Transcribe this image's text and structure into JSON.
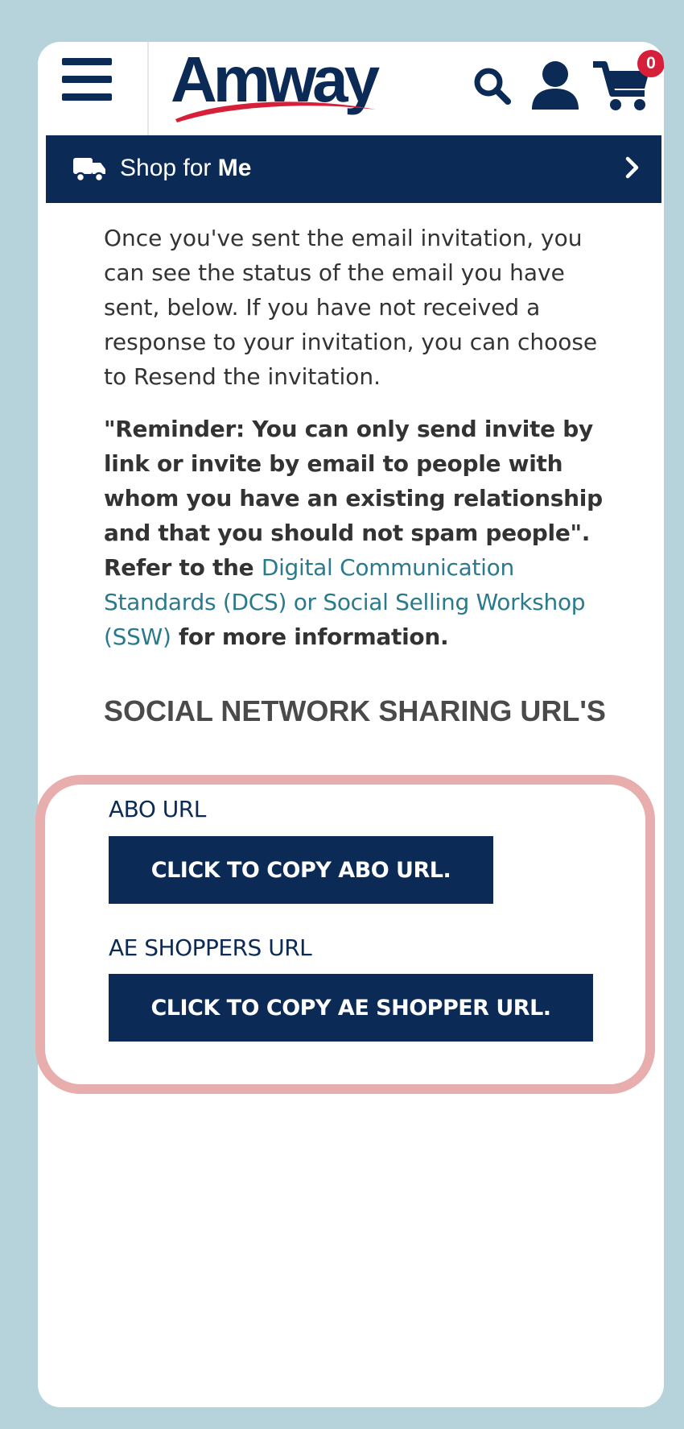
{
  "header": {
    "logo_text": "Amway",
    "cart_count": "0"
  },
  "shop_bar": {
    "prefix": "Shop for ",
    "target": "Me"
  },
  "content": {
    "intro": "Once you've sent the email invitation, you can see the status of the email you have sent, below. If you have not received a response to your invitation, you can choose to Resend the invitation.",
    "reminder": "\"Reminder: You can only send invite by link or invite by email to people with whom you have an existing relationship and that you should not spam people\". Refer to the",
    "link_text": "Digital Communication Standards (DCS) or Social Selling Workshop (SSW)",
    "reminder_suffix": "for more information."
  },
  "sharing": {
    "section_title": "SOCIAL NETWORK SHARING URL'S",
    "abo_label": "ABO URL",
    "abo_button": "CLICK TO COPY ABO URL.",
    "ae_label": "AE SHOPPERS URL",
    "ae_button": "CLICK TO COPY AE SHOPPER URL."
  },
  "colors": {
    "navy": "#0b2a55",
    "link": "#2b7a8c",
    "highlight": "#e8aeae",
    "frame": "#b6d3db",
    "badge": "#d6203a"
  },
  "icons": [
    "hamburger-icon",
    "search-icon",
    "user-icon",
    "cart-icon",
    "truck-icon",
    "chevron-right-icon"
  ]
}
